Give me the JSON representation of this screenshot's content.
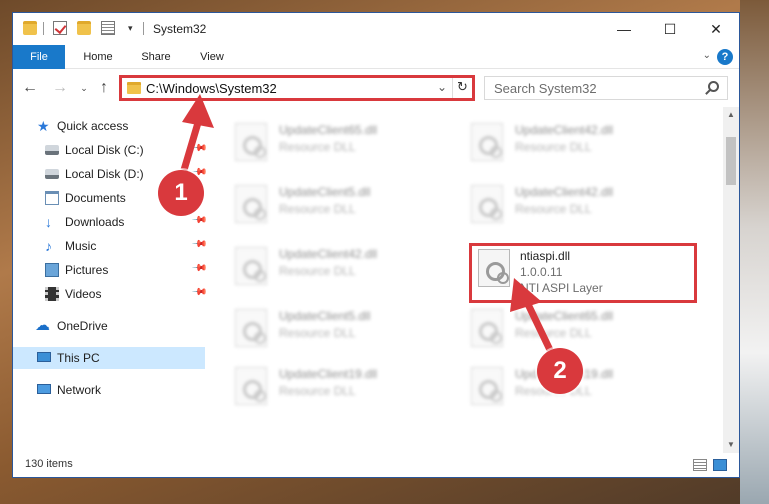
{
  "window": {
    "title": "System32",
    "minimize": "—",
    "maximize": "☐",
    "close": "✕"
  },
  "ribbon": {
    "tabs": [
      "File",
      "Home",
      "Share",
      "View"
    ],
    "help": "?"
  },
  "nav": {
    "address": "C:\\Windows\\System32",
    "search_placeholder": "Search System32"
  },
  "sidebar": {
    "items": [
      {
        "label": "Quick access",
        "icon": "star-icon"
      },
      {
        "label": "Local Disk (C:)",
        "icon": "disk-icon"
      },
      {
        "label": "Local Disk (D:)",
        "icon": "disk-icon"
      },
      {
        "label": "Documents",
        "icon": "documents-icon"
      },
      {
        "label": "Downloads",
        "icon": "downloads-icon"
      },
      {
        "label": "Music",
        "icon": "music-icon"
      },
      {
        "label": "Pictures",
        "icon": "pictures-icon"
      },
      {
        "label": "Videos",
        "icon": "videos-icon"
      },
      {
        "label": "OneDrive",
        "icon": "onedrive-icon"
      },
      {
        "label": "This PC",
        "icon": "this-pc-icon"
      },
      {
        "label": "Network",
        "icon": "network-icon"
      }
    ]
  },
  "files": [
    {
      "name": "UpdateClient65.dll",
      "type": "Resource DLL"
    },
    {
      "name": "UpdateClient42.dll",
      "type": "Resource DLL"
    },
    {
      "name": "UpdateClient5.dll",
      "type": "Resource DLL"
    },
    {
      "name": "UpdateClient42.dll",
      "type": "Resource DLL"
    },
    {
      "name": "UpdateClient42.dll",
      "type": "Resource DLL"
    },
    {
      "name": "ntiaspi.dll",
      "version": "1.0.0.11",
      "type": "NTI ASPI Layer"
    },
    {
      "name": "UpdateClient5.dll",
      "type": "Resource DLL"
    },
    {
      "name": "UpdateClient65.dll",
      "type": "Resource DLL"
    },
    {
      "name": "UpdateClient19.dll",
      "type": "Resource DLL"
    },
    {
      "name": "UpdateClient19.dll",
      "type": "Resource DLL"
    }
  ],
  "status": {
    "item_count": "130 items"
  },
  "annotations": [
    "1",
    "2"
  ],
  "colors": {
    "accent": "#1979ca",
    "highlight": "#d9393d",
    "selected": "#cce8ff"
  }
}
